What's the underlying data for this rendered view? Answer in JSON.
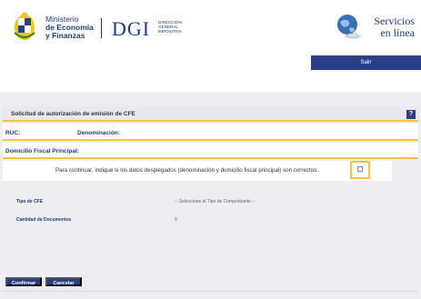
{
  "header": {
    "ministry_line1": "Ministerio",
    "ministry_line2": "de Economía",
    "ministry_line3": "y Finanzas",
    "dgi_logo": "DGI",
    "dgi_sub_line1": "Dirección",
    "dgi_sub_line2": "General",
    "dgi_sub_line3": "Impositiva",
    "servicios_line1": "Servicios",
    "servicios_line2": "en línea",
    "salir_label": "Salir",
    "icons": [
      "coat-of-arms-icon",
      "globe-icon"
    ]
  },
  "form": {
    "title": "Solicitud de autorización de emisión de CFE",
    "help_label": "?",
    "ruc_label": "RUC:",
    "denominacion_label": "Denominación:",
    "domicilio_label": "Domicilio Fiscal Principal:",
    "confirm_text": "Para continuar, indique si los datos desplegados (denominación y domicilio fiscal principal) son correctos.",
    "tipo_cfe_label": "Tipo de CFE",
    "tipo_cfe_value": "-- Seleccione el Tipo de Comprobante --",
    "cantidad_label": "Cantidad de Documentos",
    "cantidad_value": "0"
  },
  "buttons": {
    "confirmar": "Confirmar",
    "cancelar": "Cancelar"
  },
  "colors": {
    "brand_blue": "#2b3f87",
    "highlight_yellow": "#f4c542",
    "label_blue": "#1f3d7a"
  }
}
